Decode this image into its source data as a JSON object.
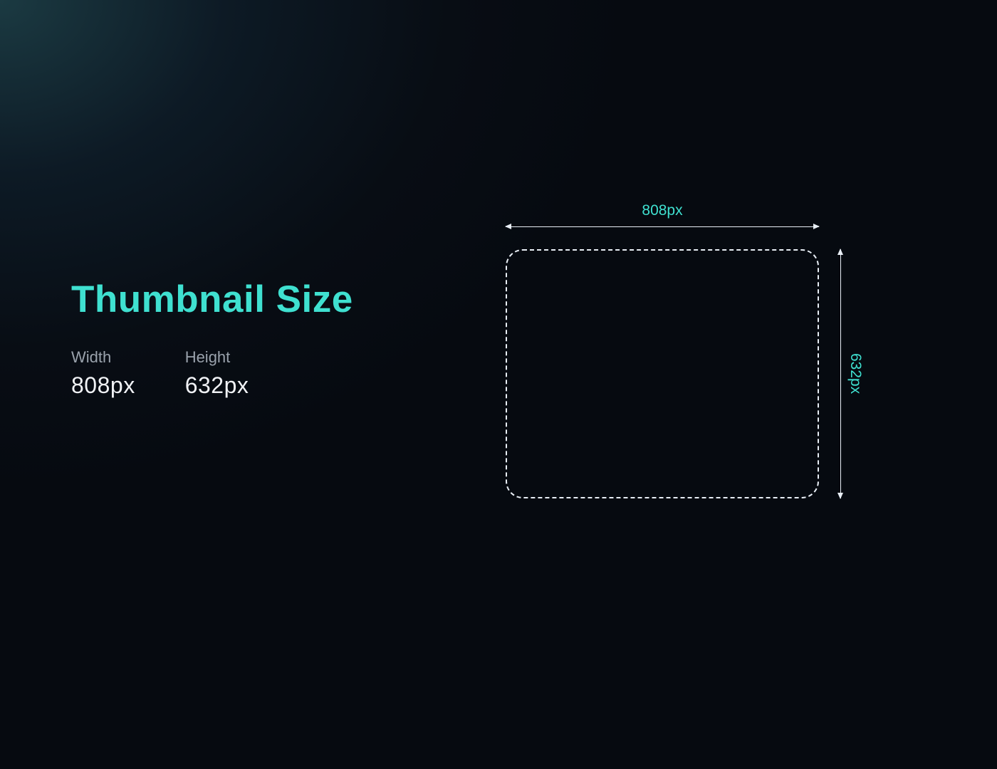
{
  "title": "Thumbnail Size",
  "width_label": "Width",
  "width_value": "808px",
  "height_label": "Height",
  "height_value": "632px",
  "diagram": {
    "h_label": "808px",
    "v_label": "632px"
  },
  "colors": {
    "accent": "#3fe0d0",
    "text_muted": "#9aa2ac",
    "text": "#f0f2f5",
    "line": "#e8eef5"
  }
}
